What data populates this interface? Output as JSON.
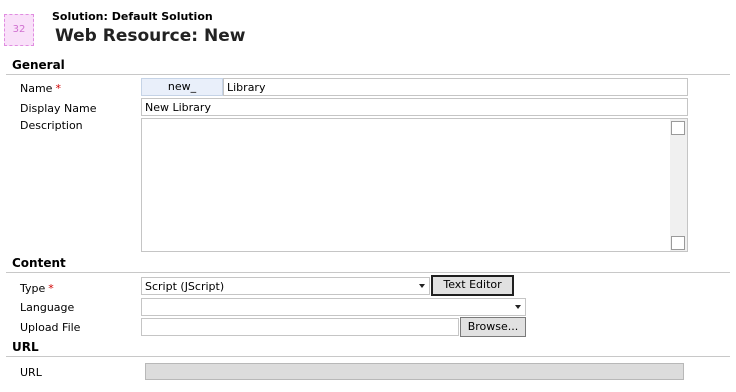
{
  "header": {
    "placeholder_icon_text": "32",
    "solution_label": "Solution: Default Solution",
    "title": "Web Resource: New"
  },
  "general": {
    "section_title": "General",
    "name": {
      "label": "Name",
      "required": "*",
      "prefix": "new_",
      "value": "Library"
    },
    "display_name": {
      "label": "Display Name",
      "value": "New Library"
    },
    "description": {
      "label": "Description",
      "value": ""
    }
  },
  "content": {
    "section_title": "Content",
    "type": {
      "label": "Type",
      "required": "*",
      "selected": "Script (JScript)"
    },
    "text_editor_button": "Text Editor",
    "language": {
      "label": "Language",
      "selected": ""
    },
    "upload_file": {
      "label": "Upload File",
      "value": "",
      "browse_button": "Browse..."
    }
  },
  "url": {
    "section_title": "URL",
    "field": {
      "label": "URL",
      "value": ""
    }
  }
}
